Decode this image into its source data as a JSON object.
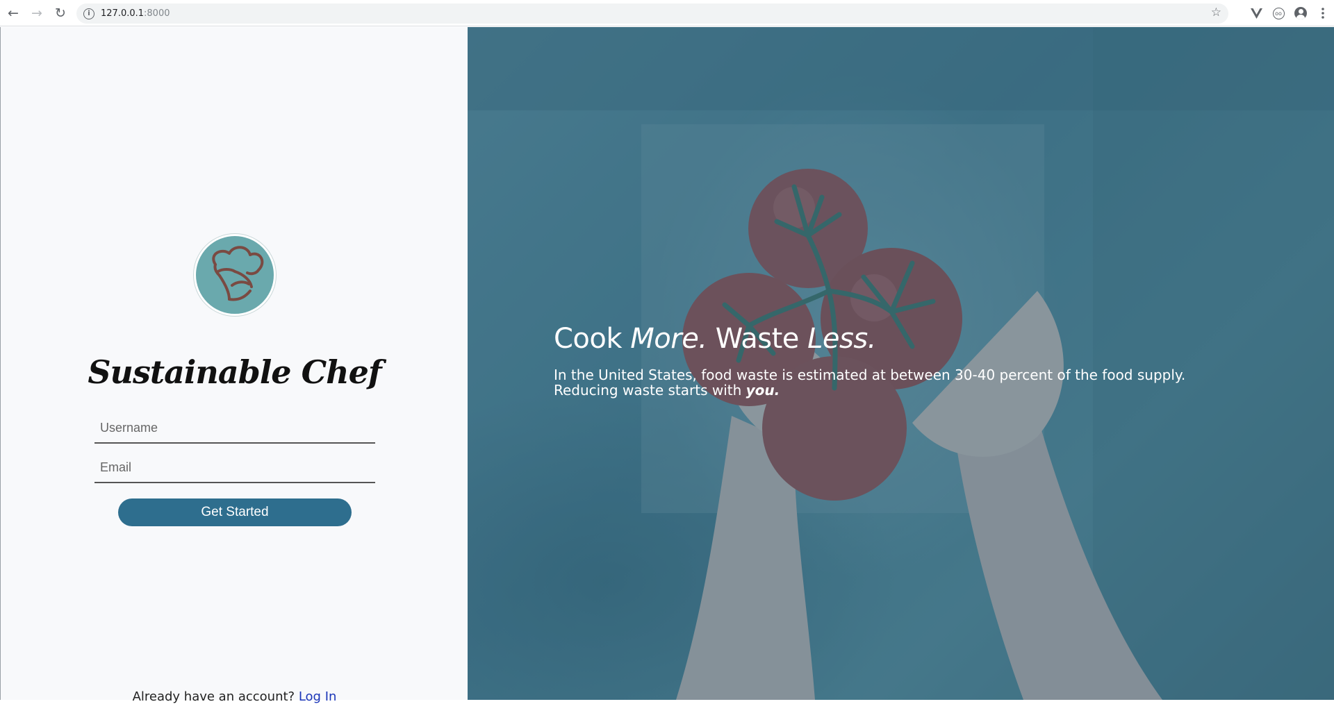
{
  "browser": {
    "url_host": "127.0.0.1",
    "url_port": ":8000",
    "back_icon": "arrow-left-icon",
    "forward_icon": "arrow-right-icon",
    "reload_icon": "reload-icon"
  },
  "brand": {
    "name": "Sustainable Chef",
    "logo_icon": "chef-hat-icon",
    "logo_color": "#6aa9ad"
  },
  "signup": {
    "username_placeholder": "Username",
    "email_placeholder": "Email",
    "submit_label": "Get Started",
    "submit_color": "#2e6e8e"
  },
  "footer": {
    "prompt": "Already have an account? ",
    "login_label": "Log In",
    "login_color": "#1a35b8"
  },
  "hero": {
    "headline_a": "Cook ",
    "headline_b": "More.",
    "headline_c": " Waste ",
    "headline_d": "Less.",
    "body_text": "In the United States, food waste is estimated at between 30-40 percent of the food supply. Reducing waste starts with ",
    "body_emphasis": "you."
  }
}
